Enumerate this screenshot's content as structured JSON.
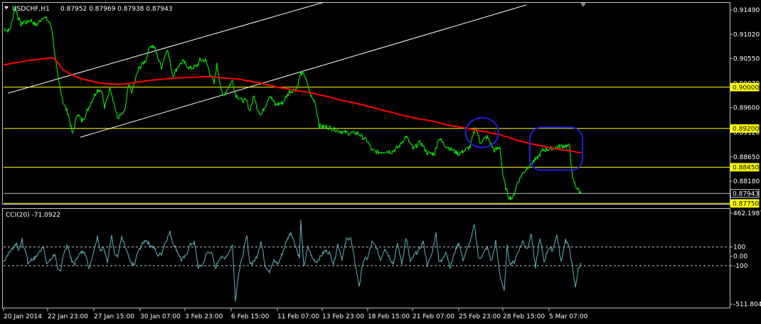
{
  "header": {
    "symbol": "USDCHF,H1",
    "ohlc": "0.87952 0.87969 0.87938 0.87943"
  },
  "indicator": {
    "label": "CCI(20) -71.0922",
    "period": 20,
    "value": -71.0922
  },
  "colors": {
    "price": "#00ff00",
    "ma": "#ff0000",
    "cci": "#5fb4be",
    "level": "#ffff00",
    "channel": "#ffffff",
    "circle": "#1f1fdd",
    "grid": "#c0c0c0"
  },
  "chart_data": [
    {
      "type": "line",
      "name": "price",
      "y_ticks": [
        "0.91490",
        "0.91020",
        "0.90550",
        "0.90070",
        "0.89600",
        "0.89120",
        "0.88650",
        "0.88180"
      ],
      "ylim": [
        0.8774,
        0.9163
      ],
      "level_labels": [
        "0.90000",
        "0.89200",
        "0.88450",
        "0.87943",
        "0.87750"
      ],
      "levels": [
        0.9,
        0.892,
        0.8845,
        0.8775
      ],
      "current_price": 0.87943,
      "x_labels": [
        "20 Jan 2014",
        "22 Jan 23:00",
        "27 Jan 15:00",
        "30 Jan 07:00",
        "3 Feb 23:00",
        "6 Feb 15:00",
        "11 Feb 07:00",
        "13 Feb 23:00",
        "18 Feb 15:00",
        "21 Feb 07:00",
        "25 Feb 23:00",
        "28 Feb 15:00",
        "5 Mar 07:00"
      ],
      "x": [
        0,
        4,
        8,
        12,
        14,
        16,
        21,
        25,
        28,
        32,
        38,
        46,
        56,
        64,
        68,
        72,
        77,
        80,
        84,
        91,
        97,
        104,
        110,
        116,
        122,
        132,
        138,
        142,
        150,
        160,
        170,
        176,
        180,
        190,
        200,
        206,
        212,
        222,
        230,
        238,
        246,
        252,
        262,
        272,
        276,
        284,
        296,
        300,
        308,
        322,
        326,
        334,
        342,
        346,
        352,
        356,
        362,
        368,
        374,
        382,
        392,
        402,
        412,
        418,
        424,
        428,
        434,
        438,
        444,
        458,
        470,
        484,
        498,
        512,
        518,
        526,
        536,
        546,
        556,
        566,
        576,
        586,
        596,
        606,
        612,
        620,
        630,
        640,
        650,
        656,
        664,
        670,
        680,
        690,
        698,
        702,
        706,
        710,
        716,
        722,
        730,
        740,
        750,
        758,
        770,
        784,
        796,
        800,
        806,
        812
      ],
      "series": [
        {
          "values": [
            0.9114,
            0.9111,
            0.9109,
            0.9127,
            0.9142,
            0.9155,
            0.9134,
            0.9119,
            0.9128,
            0.9125,
            0.913,
            0.9119,
            0.9137,
            0.9126,
            0.9113,
            0.9064,
            0.9013,
            0.8996,
            0.897,
            0.8948,
            0.8908,
            0.895,
            0.8934,
            0.8948,
            0.8968,
            0.8995,
            0.8994,
            0.8959,
            0.9,
            0.894,
            0.8951,
            0.9004,
            0.8989,
            0.9036,
            0.9052,
            0.9081,
            0.9077,
            0.9038,
            0.9075,
            0.9022,
            0.9041,
            0.905,
            0.9036,
            0.9041,
            0.9052,
            0.9052,
            0.9006,
            0.9044,
            0.8981,
            0.9013,
            0.8986,
            0.8975,
            0.8973,
            0.8954,
            0.8982,
            0.8962,
            0.8946,
            0.8964,
            0.8985,
            0.8966,
            0.8969,
            0.8991,
            0.8997,
            0.9027,
            0.9022,
            0.9001,
            0.8977,
            0.8972,
            0.8925,
            0.8922,
            0.8916,
            0.8911,
            0.8911,
            0.8895,
            0.8877,
            0.8874,
            0.8876,
            0.8875,
            0.8885,
            0.8905,
            0.888,
            0.8894,
            0.8872,
            0.8871,
            0.8902,
            0.8888,
            0.8879,
            0.8871,
            0.8879,
            0.8885,
            0.8924,
            0.8893,
            0.8904,
            0.8877,
            0.8884,
            0.8829,
            0.8806,
            0.8788,
            0.8785,
            0.8813,
            0.8833,
            0.885,
            0.8862,
            0.8878,
            0.8881,
            0.8886,
            0.8886,
            0.8822,
            0.8805,
            0.8794
          ]
        },
        {
          "name": "",
          "values": [
            0.9043,
            0.9044,
            0.9045,
            0.9046,
            0.9047,
            0.9047,
            0.9048,
            0.9049,
            0.905,
            0.9051,
            0.9052,
            0.9053,
            0.9055,
            0.9056,
            0.9057,
            0.9054,
            0.9046,
            0.904,
            0.9033,
            0.9028,
            0.9023,
            0.9019,
            0.9016,
            0.9014,
            0.9012,
            0.9009,
            0.9007,
            0.9007,
            0.9006,
            0.9005,
            0.9006,
            0.9007,
            0.9008,
            0.901,
            0.9012,
            0.9013,
            0.9014,
            0.9015,
            0.9016,
            0.9017,
            0.9018,
            0.9018,
            0.9019,
            0.9019,
            0.902,
            0.902,
            0.902,
            0.9019,
            0.9018,
            0.9016,
            0.9016,
            0.9015,
            0.9012,
            0.9012,
            0.901,
            0.9009,
            0.9008,
            0.9005,
            0.9004,
            0.9001,
            0.8998,
            0.8996,
            0.8993,
            0.8992,
            0.8991,
            0.899,
            0.8988,
            0.8987,
            0.8985,
            0.8981,
            0.8976,
            0.8972,
            0.8968,
            0.8963,
            0.8961,
            0.8958,
            0.8954,
            0.8951,
            0.8947,
            0.8944,
            0.8941,
            0.8938,
            0.8936,
            0.8933,
            0.8931,
            0.8928,
            0.8925,
            0.8923,
            0.8921,
            0.8919,
            0.8917,
            0.8915,
            0.8913,
            0.891,
            0.8908,
            0.8906,
            0.8904,
            0.8903,
            0.89,
            0.8897,
            0.8894,
            0.8891,
            0.8888,
            0.8886,
            0.8882,
            0.8879,
            0.8877,
            0.8876,
            0.8874,
            0.8873
          ]
        }
      ],
      "channel_lines": [
        {
          "x": [
            6,
            450
          ],
          "values": [
            0.8988,
            0.9164
          ]
        },
        {
          "x": [
            108,
            735
          ],
          "values": [
            0.8903,
            0.9159
          ]
        }
      ],
      "circles": [
        {
          "cx": 678,
          "value": 0.8912
        },
        {
          "cx": 786,
          "value": 0.8893
        }
      ]
    },
    {
      "type": "line",
      "name": "cci",
      "y_ticks": [
        "462.1987",
        "100",
        "0.00",
        "-100",
        "-511.8047"
      ],
      "ylim": [
        -511.8047,
        462.1987
      ],
      "levels": [
        100,
        -100
      ],
      "x": [
        0,
        6,
        12,
        18,
        22,
        26,
        28,
        32,
        34,
        38,
        44,
        50,
        56,
        60,
        66,
        72,
        76,
        80,
        84,
        90,
        96,
        100,
        104,
        108,
        114,
        120,
        126,
        132,
        136,
        140,
        146,
        152,
        156,
        160,
        166,
        172,
        178,
        184,
        188,
        194,
        200,
        206,
        212,
        216,
        222,
        228,
        234,
        238,
        244,
        250,
        256,
        262,
        268,
        274,
        280,
        286,
        292,
        298,
        304,
        310,
        316,
        322,
        326,
        330,
        336,
        342,
        346,
        350,
        356,
        362,
        368,
        374,
        380,
        386,
        392,
        398,
        404,
        410,
        416,
        418,
        422,
        428,
        434,
        440,
        446,
        452,
        458,
        464,
        470,
        476,
        482,
        488,
        494,
        500,
        506,
        512,
        518,
        524,
        530,
        536,
        542,
        548,
        554,
        560,
        566,
        572,
        578,
        584,
        590,
        596,
        602,
        608,
        612,
        616,
        622,
        628,
        634,
        640,
        646,
        652,
        658,
        662,
        668,
        674,
        680,
        686,
        692,
        698,
        704,
        708,
        712,
        718,
        724,
        730,
        736,
        742,
        748,
        754,
        760,
        766,
        772,
        778,
        784,
        790,
        796,
        800,
        804,
        808,
        812
      ],
      "series": [
        {
          "values": [
            -60,
            20,
            80,
            140,
            60,
            180,
            100,
            40,
            -80,
            -40,
            -20,
            40,
            120,
            -80,
            -40,
            30,
            -150,
            -160,
            20,
            120,
            -60,
            -80,
            0,
            30,
            60,
            -130,
            30,
            220,
            60,
            100,
            -60,
            240,
            30,
            -10,
            200,
            80,
            -60,
            -100,
            30,
            120,
            180,
            120,
            90,
            10,
            30,
            160,
            260,
            150,
            60,
            -40,
            0,
            120,
            150,
            -120,
            -90,
            40,
            50,
            -130,
            -10,
            -20,
            30,
            120,
            -480,
            -200,
            0,
            220,
            -60,
            -80,
            0,
            160,
            -100,
            -160,
            -50,
            -80,
            30,
            170,
            260,
            130,
            -20,
            380,
            -120,
            100,
            -20,
            -60,
            0,
            60,
            40,
            -80,
            130,
            -30,
            180,
            200,
            -60,
            -320,
            -40,
            -20,
            150,
            100,
            -40,
            90,
            0,
            -80,
            140,
            -80,
            200,
            -60,
            20,
            60,
            160,
            -100,
            20,
            250,
            -40,
            -60,
            60,
            -120,
            40,
            150,
            -40,
            80,
            200,
            350,
            -30,
            20,
            100,
            -60,
            160,
            -200,
            -380,
            110,
            -80,
            -60,
            60,
            160,
            80,
            240,
            -130,
            200,
            -60,
            90,
            70,
            230,
            -70,
            180,
            80,
            -130,
            -330,
            -140,
            -71
          ]
        }
      ]
    }
  ]
}
